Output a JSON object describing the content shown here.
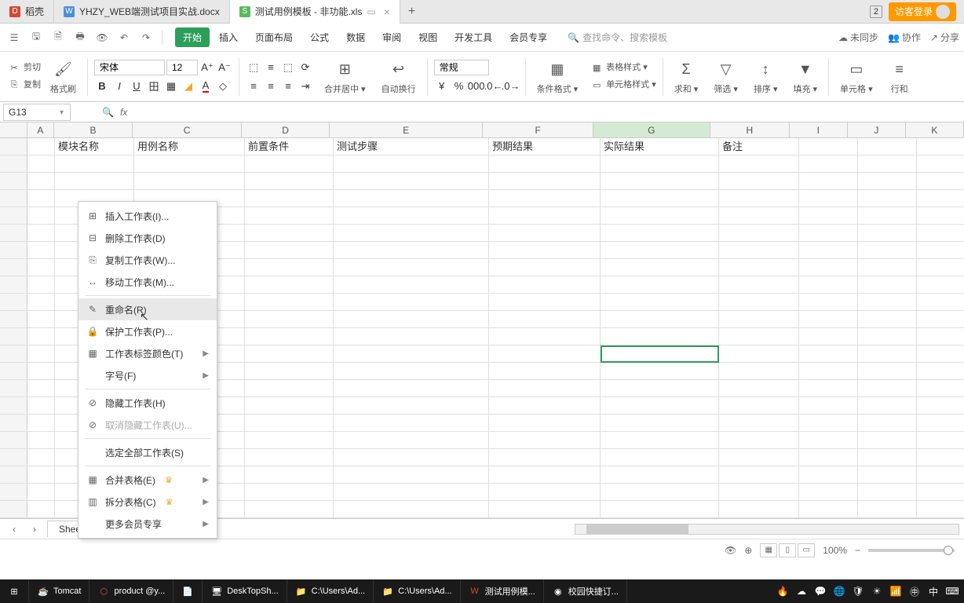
{
  "tabs": {
    "items": [
      {
        "label": "稻壳",
        "icon": "D"
      },
      {
        "label": "YHZY_WEB端测试项目实战.docx",
        "icon": "W"
      },
      {
        "label": "测试用例模板 - 非功能.xls",
        "icon": "S"
      }
    ],
    "badge": "2",
    "login": "访客登录"
  },
  "ribbon_tabs": [
    "开始",
    "插入",
    "页面布局",
    "公式",
    "数据",
    "审阅",
    "视图",
    "开发工具",
    "会员专享"
  ],
  "search_placeholder": "查找命令、搜索模板",
  "top_right": {
    "unsync": "未同步",
    "collab": "协作",
    "share": "分享"
  },
  "ribbon": {
    "cut": "剪切",
    "copy": "复制",
    "format_painter": "格式刷",
    "font_name": "宋体",
    "font_size": "12",
    "merge": "合并居中",
    "wrap": "自动换行",
    "number_format": "常规",
    "cond_fmt": "条件格式",
    "table_style": "表格样式",
    "cell_style": "单元格样式",
    "sum": "求和",
    "filter": "筛选",
    "sort": "排序",
    "fill": "填充",
    "cell": "单元格",
    "row": "行和"
  },
  "name_box": "G13",
  "columns": [
    "A",
    "B",
    "C",
    "D",
    "E",
    "F",
    "G",
    "H",
    "I",
    "J",
    "K"
  ],
  "headers": {
    "B": "模块名称",
    "C": "用例名称",
    "D": "前置条件",
    "E": "测试步骤",
    "F": "预期结果",
    "G": "实际结果",
    "H": "备注"
  },
  "context_menu": {
    "insert": "插入工作表(I)...",
    "delete": "删除工作表(D)",
    "copy": "复制工作表(W)...",
    "move": "移动工作表(M)...",
    "rename": "重命名(R)",
    "protect": "保护工作表(P)...",
    "tab_color": "工作表标签颜色(T)",
    "font_size": "字号(F)",
    "hide": "隐藏工作表(H)",
    "unhide": "取消隐藏工作表(U)...",
    "select_all": "选定全部工作表(S)",
    "merge_tbl": "合并表格(E)",
    "split_tbl": "拆分表格(C)",
    "more_vip": "更多会员专享"
  },
  "sheet_tab": "Sheet1",
  "zoom": "100%",
  "taskbar": {
    "tomcat": "Tomcat",
    "product": "product @y...",
    "desktop": "DeskTopSh...",
    "folder1": "C:\\Users\\Ad...",
    "folder2": "C:\\Users\\Ad...",
    "wps": "测试用例模...",
    "chrome": "校园快捷订..."
  }
}
